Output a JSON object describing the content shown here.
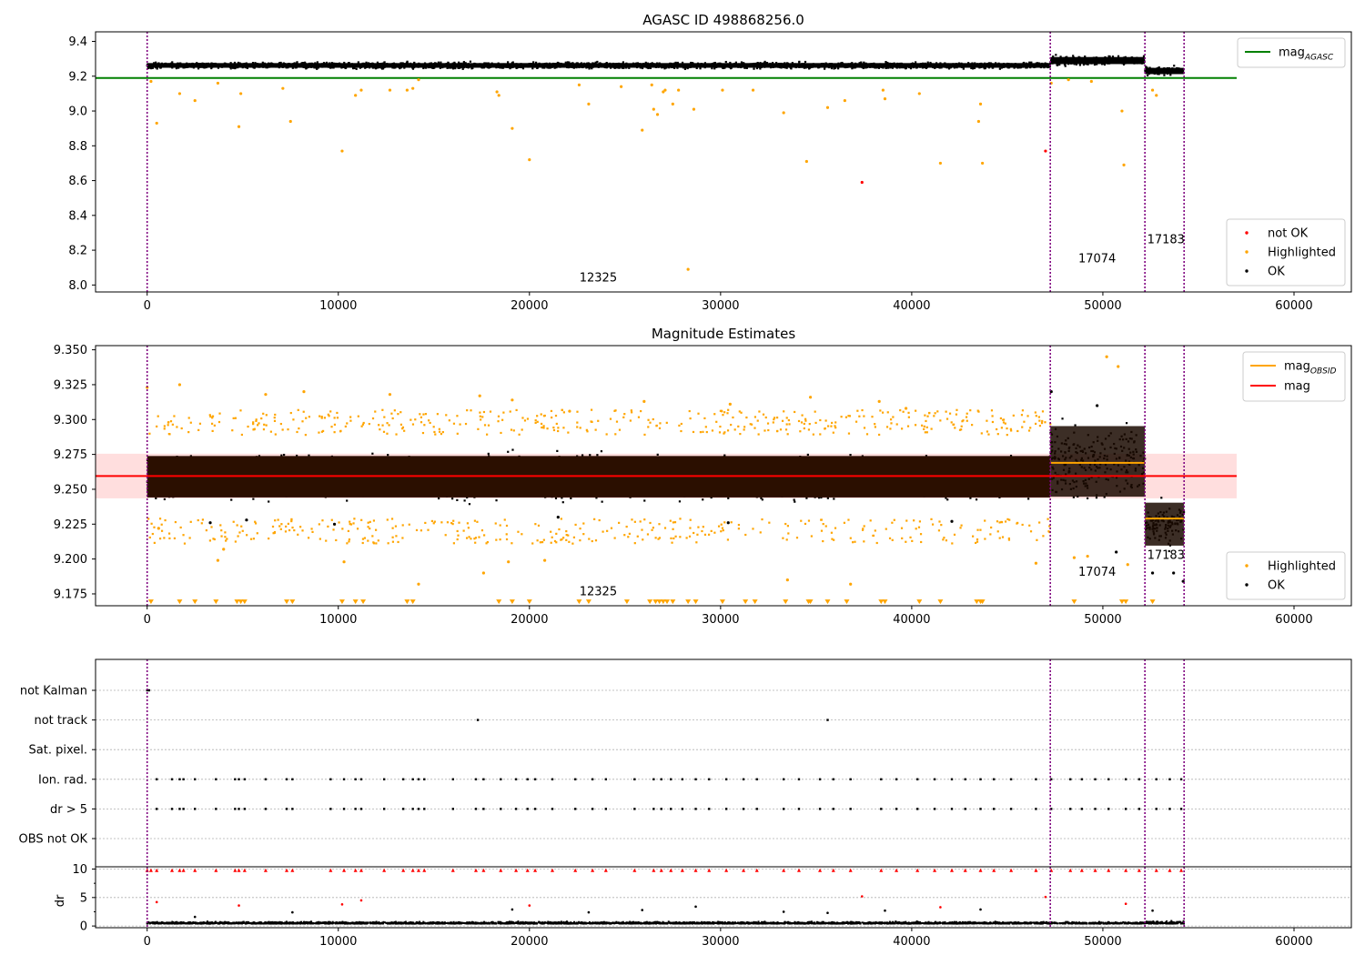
{
  "figure_title": "",
  "chart_data": [
    {
      "type": "scatter",
      "title": "AGASC ID 498868256.0",
      "xlabel": "",
      "ylabel": "",
      "xlim": [
        -2700,
        63000
      ],
      "ylim": [
        7.96,
        9.455
      ],
      "xticks": [
        0,
        10000,
        20000,
        30000,
        40000,
        50000,
        60000
      ],
      "xtick_labels": [
        "0",
        "10000",
        "20000",
        "30000",
        "40000",
        "50000",
        "60000"
      ],
      "yticks": [
        8.0,
        8.2,
        8.4,
        8.6,
        8.8,
        9.0,
        9.2,
        9.4
      ],
      "ytick_labels": [
        "8.0",
        "8.2",
        "8.4",
        "8.6",
        "8.8",
        "9.0",
        "9.2",
        "9.4"
      ],
      "grid": false,
      "obs_boundaries": [
        0,
        47250,
        52200,
        54250
      ],
      "obs_labels": [
        {
          "text": "12325",
          "x": 23600,
          "y": 8.02
        },
        {
          "text": "17074",
          "x": 49700,
          "y": 8.13
        },
        {
          "text": "17183",
          "x": 53300,
          "y": 8.24
        }
      ],
      "lines": [
        {
          "name": "mag_AGASC",
          "legend_main": "mag",
          "legend_sub": "AGASC",
          "color": "#008000",
          "x": [
            -2700,
            57000
          ],
          "y": [
            9.19,
            9.19
          ]
        }
      ],
      "band_series": [
        {
          "name": "OK",
          "color": "#000000",
          "x0": 0,
          "x1": 47250,
          "center": 9.262,
          "halfwidth": 0.03,
          "density": 1.0
        },
        {
          "name": "OK",
          "color": "#000000",
          "x0": 47250,
          "x1": 52200,
          "center": 9.29,
          "halfwidth": 0.045,
          "density": 1.0
        },
        {
          "name": "OK",
          "color": "#000000",
          "x0": 52200,
          "x1": 54250,
          "center": 9.23,
          "halfwidth": 0.04,
          "density": 1.0
        }
      ],
      "series": [
        {
          "name": "Highlighted",
          "color": "#ffa500",
          "x": [
            200,
            500,
            1700,
            2500,
            3700,
            4800,
            4900,
            7100,
            7500,
            10200,
            10900,
            11200,
            12700,
            13600,
            13900,
            14200,
            18300,
            18400,
            19100,
            20000,
            22600,
            23100,
            24800,
            25900,
            26400,
            26500,
            26700,
            27000,
            27100,
            27500,
            27800,
            28300,
            28600,
            30100,
            31700,
            33300,
            34500,
            35600,
            36500,
            38500,
            38600,
            40400,
            41500,
            43500,
            43600,
            43700,
            47300,
            48200,
            49400,
            51000,
            51100,
            52600,
            52800
          ],
          "y": [
            9.17,
            8.93,
            9.1,
            9.06,
            9.16,
            8.91,
            9.1,
            9.13,
            8.94,
            8.77,
            9.09,
            9.12,
            9.12,
            9.12,
            9.13,
            9.18,
            9.11,
            9.09,
            8.9,
            8.72,
            9.15,
            9.04,
            9.14,
            8.89,
            9.15,
            9.01,
            8.98,
            9.11,
            9.12,
            9.04,
            9.12,
            8.09,
            9.01,
            9.12,
            9.12,
            8.99,
            8.71,
            9.02,
            9.06,
            9.12,
            9.07,
            9.1,
            8.7,
            8.94,
            9.04,
            8.7,
            9.16,
            9.18,
            9.17,
            9.0,
            8.69,
            9.12,
            9.09
          ]
        },
        {
          "name": "not OK",
          "color": "#ff0000",
          "x": [
            37400,
            47000
          ],
          "y": [
            8.59,
            8.77
          ]
        }
      ],
      "legend_lines": [
        "mag_AGASC"
      ],
      "legend_points": [
        "not OK",
        "Highlighted",
        "OK"
      ]
    },
    {
      "type": "scatter",
      "title": "Magnitude Estimates",
      "xlabel": "",
      "ylabel": "",
      "xlim": [
        -2700,
        63000
      ],
      "ylim": [
        9.1665,
        9.353
      ],
      "xticks": [
        0,
        10000,
        20000,
        30000,
        40000,
        50000,
        60000
      ],
      "xtick_labels": [
        "0",
        "10000",
        "20000",
        "30000",
        "40000",
        "50000",
        "60000"
      ],
      "yticks": [
        9.175,
        9.2,
        9.225,
        9.25,
        9.275,
        9.3,
        9.325,
        9.35
      ],
      "ytick_labels": [
        "9.175",
        "9.200",
        "9.225",
        "9.250",
        "9.275",
        "9.300",
        "9.325",
        "9.350"
      ],
      "grid": false,
      "obs_boundaries": [
        0,
        47250,
        52200,
        54250
      ],
      "obs_labels": [
        {
          "text": "12325",
          "x": 23600,
          "y": 9.174
        },
        {
          "text": "17074",
          "x": 49700,
          "y": 9.188
        },
        {
          "text": "17183",
          "x": 53300,
          "y": 9.2
        }
      ],
      "mag_band": {
        "center": 9.2595,
        "halfwidth": 0.016,
        "x0": -2700,
        "x1": 57000,
        "color": "#ff0000",
        "opacity": 0.13
      },
      "lines": [
        {
          "name": "mag",
          "legend_main": "mag",
          "legend_sub": "",
          "color": "#ff0000",
          "x": [
            -2700,
            57000
          ],
          "y": [
            9.2595,
            9.2595
          ]
        },
        {
          "name": "mag_OBSID",
          "legend_main": "mag",
          "legend_sub": "OBSID",
          "color": "#ffa500",
          "x": [
            47250,
            52200
          ],
          "y": [
            9.269,
            9.269
          ]
        },
        {
          "name": "mag_OBSID_2",
          "legend_main": "",
          "legend_sub": "",
          "color": "#ffa500",
          "x": [
            52200,
            54250
          ],
          "y": [
            9.229,
            9.229
          ]
        }
      ],
      "band_series": [
        {
          "name": "OK",
          "color": "#000000",
          "x0": 0,
          "x1": 47250,
          "center": 9.259,
          "halfwidth": 0.027,
          "density": 1.0
        },
        {
          "name": "OK",
          "color": "#000000",
          "x0": 47250,
          "x1": 52200,
          "center": 9.27,
          "halfwidth": 0.046,
          "density": 0.7
        },
        {
          "name": "OK",
          "color": "#000000",
          "x0": 52200,
          "x1": 54250,
          "center": 9.225,
          "halfwidth": 0.028,
          "density": 0.8
        },
        {
          "name": "Highlighted",
          "color": "#ffa500",
          "x0": 0,
          "x1": 47250,
          "center": 9.259,
          "halfwidth": 0.04,
          "density": 0.25
        }
      ],
      "series": [
        {
          "name": "Highlighted",
          "color": "#ffa500",
          "x": [
            0,
            600,
            1700,
            3700,
            4000,
            6200,
            8200,
            10300,
            12700,
            14200,
            17400,
            17600,
            18900,
            19100,
            20800,
            22100,
            26000,
            30500,
            33500,
            34700,
            36800,
            38300,
            39700,
            46500,
            48500,
            49200,
            50200,
            50800,
            51300
          ],
          "y": [
            9.323,
            9.222,
            9.325,
            9.199,
            9.207,
            9.318,
            9.32,
            9.198,
            9.318,
            9.182,
            9.317,
            9.19,
            9.198,
            9.314,
            9.199,
            9.306,
            9.313,
            9.311,
            9.185,
            9.316,
            9.182,
            9.313,
            9.308,
            9.197,
            9.201,
            9.202,
            9.345,
            9.338,
            9.196
          ]
        },
        {
          "name": "Highlighted_clip",
          "color": "#ffa500",
          "marker": "triangle-down",
          "x": [
            200,
            1700,
            2500,
            3600,
            4700,
            4900,
            5100,
            7300,
            7600,
            10200,
            10900,
            11300,
            13600,
            13900,
            18400,
            19100,
            20000,
            22600,
            23100,
            25100,
            26300,
            26600,
            26800,
            27000,
            27200,
            27500,
            28300,
            28700,
            30100,
            31300,
            31800,
            33400,
            34600,
            34700,
            35600,
            36600,
            38400,
            38600,
            40400,
            41500,
            43400,
            43600,
            43700,
            48500,
            51000,
            51200,
            52600
          ],
          "y": [
            9.169,
            9.169,
            9.169,
            9.169,
            9.169,
            9.169,
            9.169,
            9.169,
            9.169,
            9.169,
            9.169,
            9.169,
            9.169,
            9.169,
            9.169,
            9.169,
            9.169,
            9.169,
            9.169,
            9.169,
            9.169,
            9.169,
            9.169,
            9.169,
            9.169,
            9.169,
            9.169,
            9.169,
            9.169,
            9.169,
            9.169,
            9.169,
            9.169,
            9.169,
            9.169,
            9.169,
            9.169,
            9.169,
            9.169,
            9.169,
            9.169,
            9.169,
            9.169,
            9.169,
            9.169,
            9.169,
            9.169
          ]
        },
        {
          "name": "OK_extra",
          "color": "#000000",
          "x": [
            3300,
            5200,
            9800,
            21500,
            30400,
            42100,
            47300,
            49700,
            50700,
            52600,
            53700,
            54200
          ],
          "y": [
            9.226,
            9.228,
            9.225,
            9.23,
            9.226,
            9.227,
            9.32,
            9.31,
            9.205,
            9.19,
            9.19,
            9.184
          ]
        }
      ],
      "legend_lines": [
        "mag_OBSID",
        "mag"
      ],
      "legend_points": [
        "Highlighted",
        "OK"
      ]
    },
    {
      "type": "scatter",
      "title": "",
      "xlabel": "",
      "ylabel": "",
      "xlim": [
        -2700,
        63000
      ],
      "xticks": [
        0,
        10000,
        20000,
        30000,
        40000,
        50000,
        60000
      ],
      "xtick_labels": [
        "0",
        "10000",
        "20000",
        "30000",
        "40000",
        "50000",
        "60000"
      ],
      "grid": true,
      "obs_boundaries": [
        0,
        47250,
        52200,
        54250
      ],
      "flag_rows": [
        "not Kalman",
        "not track",
        "Sat. pixel.",
        "Ion. rad.",
        "dr > 5",
        "OBS not OK"
      ],
      "flag_points": [
        {
          "row": "not Kalman",
          "x": [
            0,
            100
          ]
        },
        {
          "row": "not track",
          "x": [
            17300,
            35600
          ]
        },
        {
          "row": "Sat. pixel.",
          "x": []
        },
        {
          "row": "Ion. rad.",
          "x": [
            500,
            1300,
            1700,
            1900,
            2500,
            3600,
            4600,
            4800,
            5100,
            6200,
            7300,
            7600,
            9600,
            10300,
            10900,
            11200,
            12400,
            13400,
            13900,
            14200,
            14500,
            16000,
            17200,
            17600,
            18500,
            19300,
            19900,
            20300,
            21200,
            22400,
            23300,
            24000,
            25500,
            26500,
            26900,
            27400,
            28000,
            28700,
            29400,
            30300,
            31200,
            31900,
            33300,
            34100,
            35200,
            35900,
            36800,
            38400,
            39200,
            40300,
            41200,
            42100,
            42800,
            43600,
            44300,
            45200,
            46500,
            47300,
            48300,
            48900,
            49600,
            50300,
            51200,
            51900,
            52800,
            53500,
            54100
          ]
        },
        {
          "row": "dr > 5",
          "x": [
            500,
            1300,
            1700,
            1900,
            2500,
            3600,
            4600,
            4800,
            5100,
            6200,
            7300,
            7600,
            9600,
            10300,
            10900,
            11200,
            12400,
            13400,
            13900,
            14200,
            14500,
            16000,
            17200,
            17600,
            18500,
            19300,
            19900,
            20300,
            21200,
            22400,
            23300,
            24000,
            25500,
            26500,
            26900,
            27400,
            28000,
            28700,
            29400,
            30300,
            31200,
            31900,
            33300,
            34100,
            35200,
            35900,
            36800,
            38400,
            39200,
            40300,
            41200,
            42100,
            42800,
            43600,
            44300,
            45200,
            46500,
            47300,
            48300,
            48900,
            49600,
            50300,
            51200,
            51900,
            52800,
            53500,
            54100
          ]
        },
        {
          "row": "OBS not OK",
          "x": []
        }
      ],
      "dr_panel": {
        "ylabel": "dr",
        "ylim": [
          -0.3,
          10.4
        ],
        "yticks": [
          0,
          5,
          10
        ],
        "ytick_labels": [
          "0",
          "5",
          "10"
        ],
        "grid": true,
        "base": {
          "color": "#000000",
          "center": 0.4,
          "halfwidth": 0.45
        },
        "clipped": {
          "color": "#ff0000",
          "y": 9.8,
          "x": [
            0,
            200,
            500,
            1300,
            1700,
            1900,
            2500,
            3600,
            4600,
            4800,
            5100,
            6200,
            7300,
            7600,
            9600,
            10300,
            10900,
            11200,
            12400,
            13400,
            13900,
            14200,
            14500,
            16000,
            17200,
            17600,
            18500,
            19300,
            19900,
            20300,
            21200,
            22400,
            23300,
            24000,
            25500,
            26500,
            26900,
            27400,
            28000,
            28700,
            29400,
            30300,
            31200,
            31900,
            33300,
            34100,
            35200,
            35900,
            36800,
            38400,
            39200,
            40300,
            41200,
            42100,
            42800,
            43600,
            44300,
            45200,
            46500,
            47300,
            48300,
            48900,
            49600,
            50300,
            51200,
            51900,
            52800,
            53500,
            54100
          ]
        },
        "mid_red": {
          "color": "#ff0000",
          "x": [
            500,
            4800,
            10200,
            11200,
            20000,
            37400,
            41500,
            47000,
            51200
          ],
          "y": [
            4.2,
            3.6,
            3.8,
            4.5,
            3.6,
            5.2,
            3.3,
            5.1,
            3.9
          ]
        },
        "mid_black": {
          "color": "#000000",
          "x": [
            2500,
            7600,
            19100,
            23100,
            25900,
            28700,
            33300,
            35600,
            38600,
            43600,
            52600
          ],
          "y": [
            1.6,
            2.4,
            2.9,
            2.4,
            2.8,
            3.4,
            2.5,
            2.3,
            2.7,
            2.9,
            2.7
          ]
        }
      }
    }
  ]
}
